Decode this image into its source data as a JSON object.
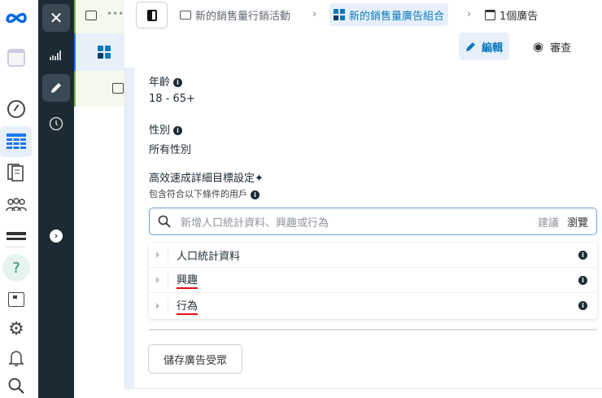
{
  "breadcrumb": {
    "campaign": "新的銷售量行銷活動",
    "adset": "新的銷售量廣告組合",
    "ads": "1個廣告"
  },
  "toolbar": {
    "edit": "編輯",
    "review": "審查"
  },
  "audience": {
    "age_label": "年齡",
    "age_value": "18 - 65+",
    "gender_label": "性別",
    "gender_value": "所有性別",
    "targeting_label": "高效速成詳細目標設定✦",
    "include_label": "包含符合以下條件的用戶",
    "search_placeholder": "新增人口統計資料、興趣或行為",
    "suggest": "建議",
    "browse": "瀏覽",
    "categories": [
      {
        "label": "人口統計資料"
      },
      {
        "label": "興趣"
      },
      {
        "label": "行為"
      }
    ],
    "save_button": "儲存廣告受眾"
  },
  "colors": {
    "accent": "#0a78be",
    "dark_panel": "#1c2b33",
    "meta_blue": "#0668e1"
  }
}
